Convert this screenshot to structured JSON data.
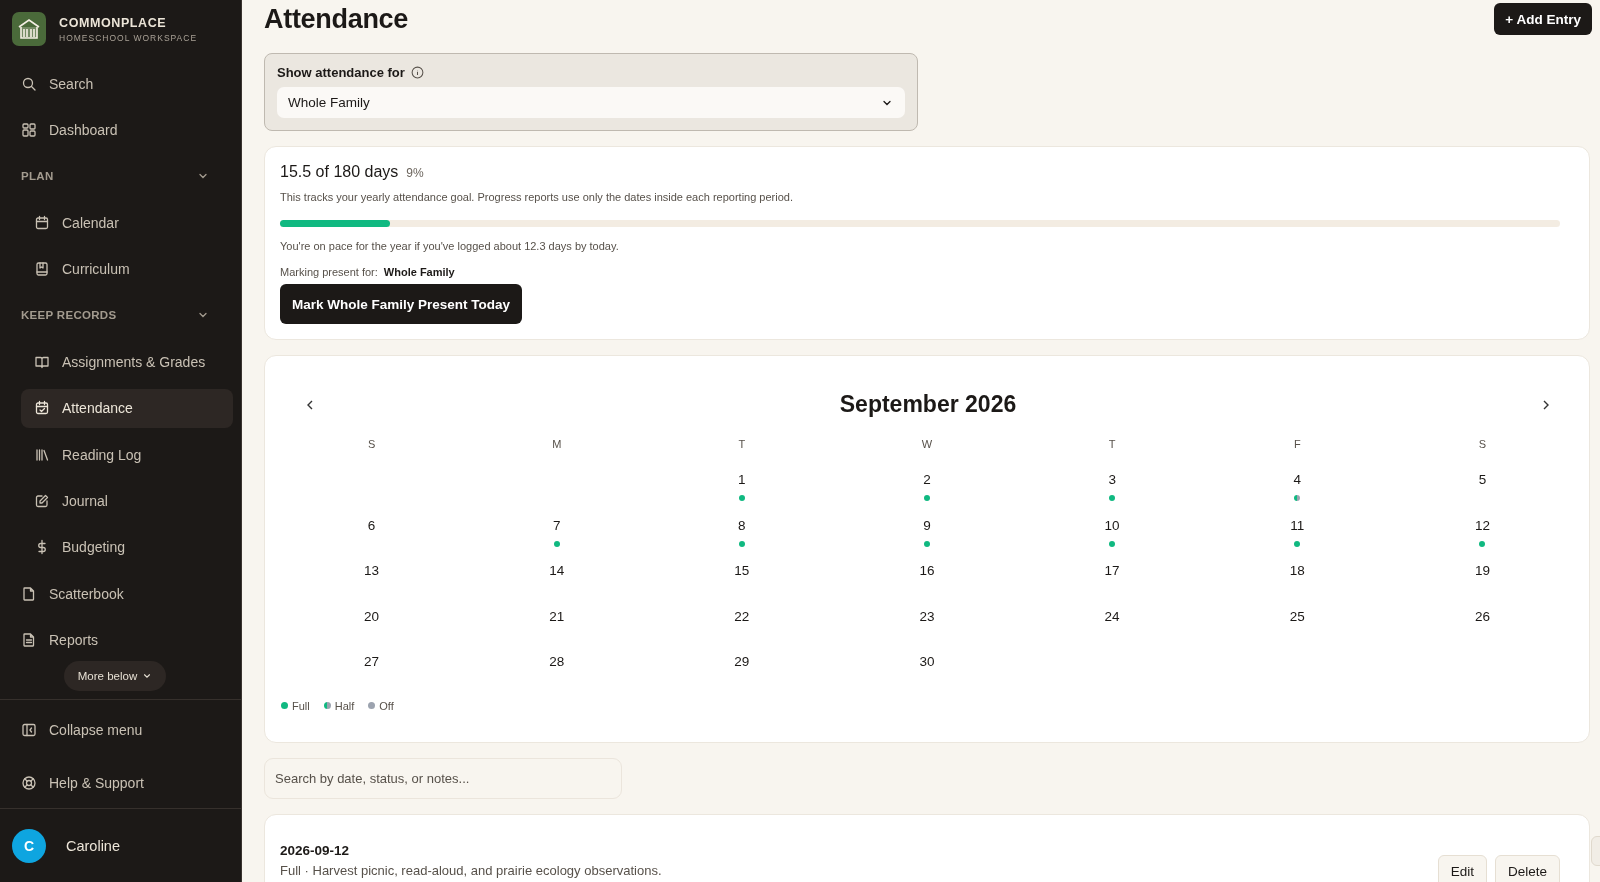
{
  "brand": {
    "name": "COMMONPLACE",
    "tagline": "HOMESCHOOL WORKSPACE"
  },
  "sidebar": {
    "top_items": [
      {
        "label": "Search",
        "selected": false
      },
      {
        "label": "Dashboard",
        "selected": false
      }
    ],
    "sections": [
      {
        "title": "PLAN",
        "expanded": true,
        "items": [
          {
            "label": "Calendar",
            "selected": false
          },
          {
            "label": "Curriculum",
            "selected": false
          }
        ]
      },
      {
        "title": "KEEP RECORDS",
        "expanded": true,
        "items": [
          {
            "label": "Assignments & Grades",
            "selected": false
          },
          {
            "label": "Attendance",
            "selected": true
          },
          {
            "label": "Reading Log",
            "selected": false
          },
          {
            "label": "Journal",
            "selected": false
          },
          {
            "label": "Budgeting",
            "selected": false
          }
        ]
      }
    ],
    "bottom_items": [
      {
        "label": "Scatterbook",
        "selected": false
      },
      {
        "label": "Reports",
        "selected": false
      }
    ],
    "more_button": "More below",
    "footer_items": [
      {
        "label": "Collapse menu"
      },
      {
        "label": "Help & Support"
      }
    ],
    "user": {
      "initial": "C",
      "name": "Caroline"
    }
  },
  "page": {
    "title": "Attendance",
    "add_button": "+ Add Entry"
  },
  "filter": {
    "label": "Show attendance for",
    "value": "Whole Family"
  },
  "progress": {
    "headline": "15.5 of 180 days",
    "percent": "9%",
    "description": "This tracks your yearly attendance goal. Progress reports use only the dates inside each reporting period.",
    "level": 0.086,
    "pace_note": "You're on pace for the year if you've logged about 12.3 days by today.",
    "marking_label": "Marking present for:",
    "marking_value": "Whole Family",
    "mark_button": "Mark Whole Family Present Today"
  },
  "calendar": {
    "month": "September 2026",
    "weekdays": [
      "S",
      "M",
      "T",
      "W",
      "T",
      "F",
      "S"
    ],
    "weeks": [
      [
        {
          "kind": "blank"
        },
        {
          "kind": "blank"
        },
        {
          "kind": "full",
          "label": "1"
        },
        {
          "kind": "full",
          "label": "2"
        },
        {
          "kind": "full",
          "label": "3"
        },
        {
          "kind": "half",
          "label": "4"
        },
        {
          "kind": "plain",
          "label": "5"
        }
      ],
      [
        {
          "kind": "plain",
          "label": "6"
        },
        {
          "kind": "full",
          "label": "7"
        },
        {
          "kind": "full",
          "label": "8"
        },
        {
          "kind": "full",
          "label": "9"
        },
        {
          "kind": "full",
          "label": "10"
        },
        {
          "kind": "full",
          "label": "11"
        },
        {
          "kind": "full",
          "label": "12"
        }
      ],
      [
        {
          "kind": "plain",
          "label": "13"
        },
        {
          "kind": "plain",
          "label": "14"
        },
        {
          "kind": "plain",
          "label": "15"
        },
        {
          "kind": "plain",
          "label": "16"
        },
        {
          "kind": "plain",
          "label": "17"
        },
        {
          "kind": "plain",
          "label": "18"
        },
        {
          "kind": "plain",
          "label": "19"
        }
      ],
      [
        {
          "kind": "plain",
          "label": "20"
        },
        {
          "kind": "plain",
          "label": "21"
        },
        {
          "kind": "plain",
          "label": "22"
        },
        {
          "kind": "plain",
          "label": "23"
        },
        {
          "kind": "plain",
          "label": "24"
        },
        {
          "kind": "plain",
          "label": "25"
        },
        {
          "kind": "plain",
          "label": "26"
        }
      ],
      [
        {
          "kind": "plain",
          "label": "27"
        },
        {
          "kind": "plain",
          "label": "28"
        },
        {
          "kind": "plain",
          "label": "29"
        },
        {
          "kind": "plain",
          "label": "30"
        },
        {
          "kind": "blank"
        },
        {
          "kind": "blank"
        },
        {
          "kind": "blank"
        }
      ]
    ],
    "legend": [
      {
        "label": "Full",
        "kind": "full"
      },
      {
        "label": "Half",
        "kind": "half"
      },
      {
        "label": "Off",
        "kind": "off"
      }
    ]
  },
  "search": {
    "placeholder": "Search by date, status, or notes..."
  },
  "entries": [
    {
      "date": "2026-09-12",
      "summary": "Full · Harvest picnic, read-aloud, and prairie ecology observations.",
      "actions": [
        "Edit",
        "Delete"
      ]
    }
  ]
}
